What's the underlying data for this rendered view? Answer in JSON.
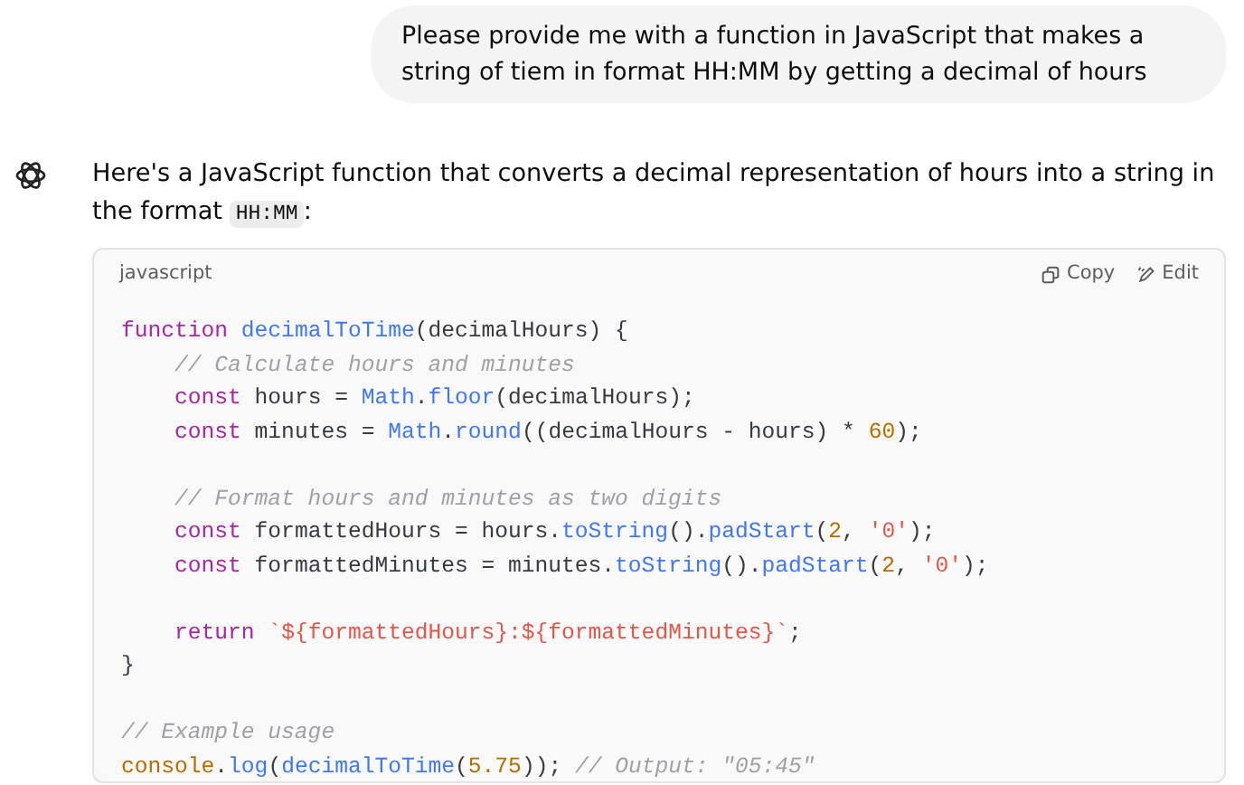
{
  "user_message": {
    "text": "Please provide me with a function in JavaScript that makes a string of tiem in format HH:MM by getting a decimal of hours"
  },
  "assistant_message": {
    "intro": {
      "text": "Here's a JavaScript function that converts a decimal representation of hours into a string in the format",
      "code": "HH:MM",
      "after": ":"
    },
    "code_block": {
      "language": "javascript",
      "actions": [
        {
          "kind": "copy",
          "label": "Copy"
        },
        {
          "kind": "edit",
          "label": "Edit"
        }
      ],
      "lines": [
        {
          "kind": "code",
          "tokens": [
            {
              "kind": "keyword",
              "text": "function "
            },
            {
              "kind": "function",
              "text": "decimalToTime"
            },
            {
              "kind": "plain",
              "text": "(decimalHours) {"
            }
          ]
        },
        {
          "kind": "code",
          "tokens": [
            {
              "kind": "comment",
              "text": "    // Calculate hours and minutes"
            }
          ]
        },
        {
          "kind": "code",
          "tokens": [
            {
              "kind": "keyword",
              "text": "    const"
            },
            {
              "kind": "plain",
              "text": " hours = "
            },
            {
              "kind": "function",
              "text": "Math"
            },
            {
              "kind": "plain",
              "text": "."
            },
            {
              "kind": "function",
              "text": "floor"
            },
            {
              "kind": "plain",
              "text": "(decimalHours);"
            }
          ]
        },
        {
          "kind": "code",
          "tokens": [
            {
              "kind": "keyword",
              "text": "    const"
            },
            {
              "kind": "plain",
              "text": " minutes = "
            },
            {
              "kind": "function",
              "text": "Math"
            },
            {
              "kind": "plain",
              "text": "."
            },
            {
              "kind": "function",
              "text": "round"
            },
            {
              "kind": "plain",
              "text": "((decimalHours - hours) * "
            },
            {
              "kind": "number",
              "text": "60"
            },
            {
              "kind": "plain",
              "text": ");"
            }
          ]
        },
        {
          "kind": "blank"
        },
        {
          "kind": "code",
          "tokens": [
            {
              "kind": "comment",
              "text": "    // Format hours and minutes as two digits"
            }
          ]
        },
        {
          "kind": "code",
          "tokens": [
            {
              "kind": "keyword",
              "text": "    const"
            },
            {
              "kind": "plain",
              "text": " formattedHours = hours."
            },
            {
              "kind": "function",
              "text": "toString"
            },
            {
              "kind": "plain",
              "text": "()."
            },
            {
              "kind": "function",
              "text": "padStart"
            },
            {
              "kind": "plain",
              "text": "("
            },
            {
              "kind": "number",
              "text": "2"
            },
            {
              "kind": "plain",
              "text": ", "
            },
            {
              "kind": "string",
              "text": "'0'"
            },
            {
              "kind": "plain",
              "text": ");"
            }
          ]
        },
        {
          "kind": "code",
          "tokens": [
            {
              "kind": "keyword",
              "text": "    const"
            },
            {
              "kind": "plain",
              "text": " formattedMinutes = minutes."
            },
            {
              "kind": "function",
              "text": "toString"
            },
            {
              "kind": "plain",
              "text": "()."
            },
            {
              "kind": "function",
              "text": "padStart"
            },
            {
              "kind": "plain",
              "text": "("
            },
            {
              "kind": "number",
              "text": "2"
            },
            {
              "kind": "plain",
              "text": ", "
            },
            {
              "kind": "string",
              "text": "'0'"
            },
            {
              "kind": "plain",
              "text": ");"
            }
          ]
        },
        {
          "kind": "blank"
        },
        {
          "kind": "code",
          "tokens": [
            {
              "kind": "keyword",
              "text": "    return "
            },
            {
              "kind": "string",
              "text": "`${formattedHours}:${formattedMinutes}`"
            },
            {
              "kind": "plain",
              "text": ";"
            }
          ]
        },
        {
          "kind": "code",
          "tokens": [
            {
              "kind": "plain",
              "text": "}"
            }
          ]
        },
        {
          "kind": "blank"
        },
        {
          "kind": "code",
          "tokens": [
            {
              "kind": "comment",
              "text": "// Example usage"
            }
          ]
        },
        {
          "kind": "code",
          "tokens": [
            {
              "kind": "number",
              "text": "console"
            },
            {
              "kind": "plain",
              "text": "."
            },
            {
              "kind": "function",
              "text": "log"
            },
            {
              "kind": "plain",
              "text": "("
            },
            {
              "kind": "function",
              "text": "decimalToTime"
            },
            {
              "kind": "plain",
              "text": "("
            },
            {
              "kind": "number",
              "text": "5.75"
            },
            {
              "kind": "plain",
              "text": ")); "
            },
            {
              "kind": "comment",
              "text": "// Output: \"05:45\""
            }
          ]
        }
      ]
    }
  }
}
